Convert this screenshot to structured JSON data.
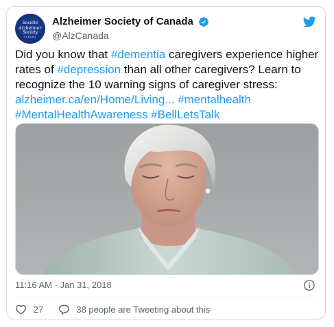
{
  "account": {
    "display_name": "Alzheimer Society of Canada",
    "handle": "@AlzCanada",
    "avatar_lines": [
      "Société",
      "Alzheimer",
      "Society",
      "CANADA"
    ]
  },
  "tweet": {
    "segments": [
      {
        "text": "Did you know that ",
        "type": "text"
      },
      {
        "text": "#dementia",
        "type": "link"
      },
      {
        "text": " caregivers experience higher rates of ",
        "type": "text"
      },
      {
        "text": "#depression",
        "type": "link"
      },
      {
        "text": " than all other caregivers? Learn to recognize the 10 warning signs of caregiver stress: ",
        "type": "text"
      },
      {
        "text": "alzheimer.ca/en/Home/Living...",
        "type": "link"
      },
      {
        "text": " ",
        "type": "text"
      },
      {
        "text": "#mentalhealth",
        "type": "link"
      },
      {
        "text": " ",
        "type": "text"
      },
      {
        "text": "#MentalHealthAwareness",
        "type": "link"
      },
      {
        "text": " ",
        "type": "text"
      },
      {
        "text": "#BellLetsTalk",
        "type": "link"
      }
    ],
    "timestamp": "11:16 AM · Jan 31, 2018"
  },
  "actions": {
    "likes": "27",
    "conversation": "38 people are Tweeting about this"
  },
  "colors": {
    "link": "#1d9bf0",
    "text": "#0f1419",
    "muted": "#536471",
    "border": "#cfd9de"
  },
  "icons": [
    "verified-badge-icon",
    "twitter-bird-icon",
    "info-icon",
    "heart-icon",
    "speech-bubble-icon"
  ]
}
